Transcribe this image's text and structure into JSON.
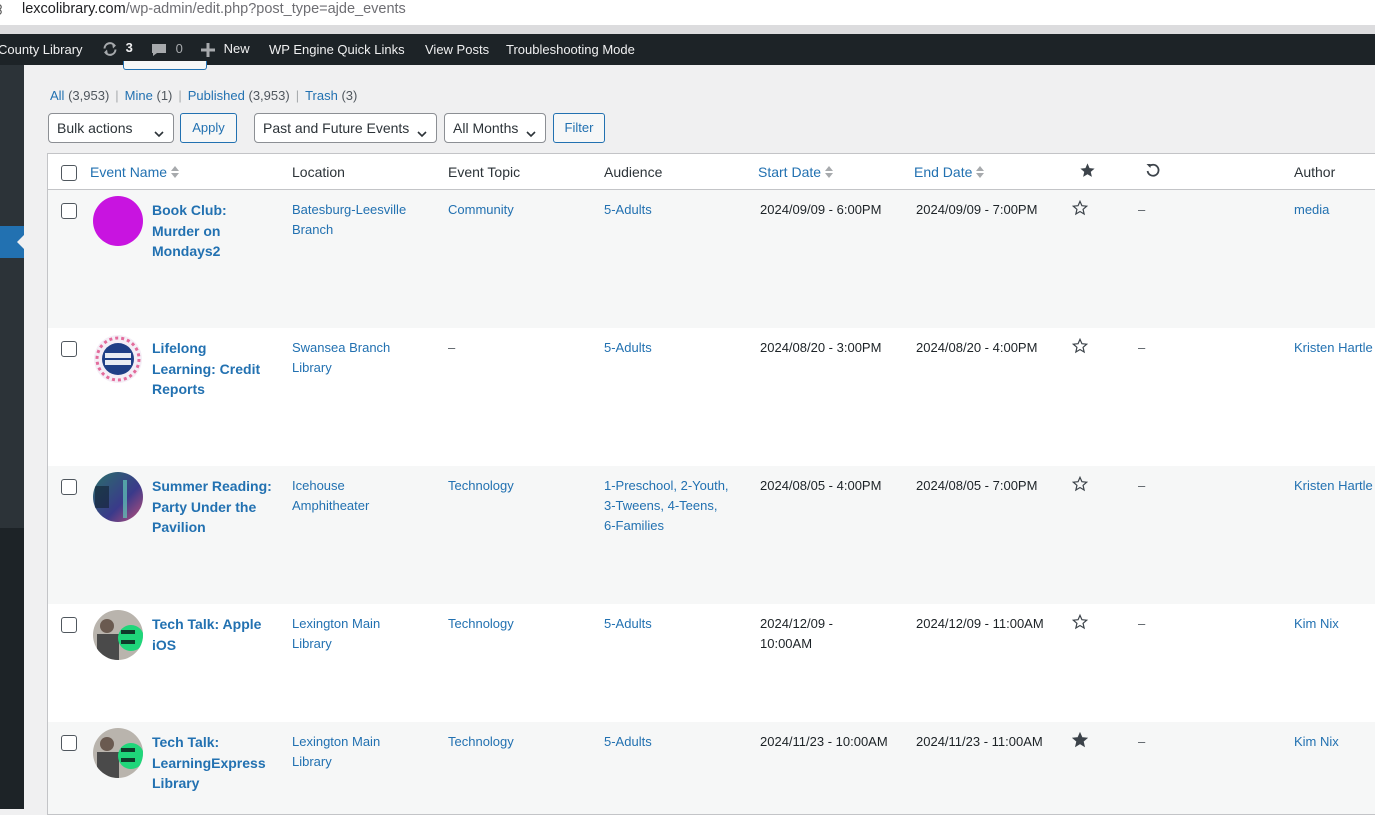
{
  "browser": {
    "url_domain": "lexcolibrary.com",
    "url_path": "/wp-admin/edit.php?post_type=ajde_events"
  },
  "adminbar": {
    "site_name": "County Library",
    "updates_count": "3",
    "comments_count": "0",
    "new_label": "New",
    "quick_links": "WP Engine Quick Links",
    "view_posts": "View Posts",
    "troubleshooting": "Troubleshooting Mode"
  },
  "filters": {
    "all_label": "All",
    "all_count": "(3,953)",
    "mine_label": "Mine",
    "mine_count": "(1)",
    "published_label": "Published",
    "published_count": "(3,953)",
    "trash_label": "Trash",
    "trash_count": "(3)",
    "separator": "|"
  },
  "controls": {
    "bulk_actions": "Bulk actions",
    "apply": "Apply",
    "event_range": "Past and Future Events",
    "months": "All Months",
    "filter": "Filter"
  },
  "columns": {
    "event_name": "Event Name",
    "location": "Location",
    "event_topic": "Event Topic",
    "audience": "Audience",
    "start_date": "Start Date",
    "end_date": "End Date",
    "author": "Author"
  },
  "rows": [
    {
      "title_lines": [
        "Book Club:",
        "Murder on",
        "Mondays2"
      ],
      "location_lines": [
        "Batesburg-Leesville",
        "Branch"
      ],
      "topic": "Community",
      "audience_lines": [
        "5-Adults"
      ],
      "start": "2024/09/09 - 6:00PM",
      "end": "2024/09/09 - 7:00PM",
      "featured": false,
      "repeat": "–",
      "author": "media"
    },
    {
      "title_lines": [
        "Lifelong",
        "Learning: Credit",
        "Reports"
      ],
      "location_lines": [
        "Swansea Branch",
        "Library"
      ],
      "topic": "–",
      "audience_lines": [
        "5-Adults"
      ],
      "start": "2024/08/20 - 3:00PM",
      "end": "2024/08/20 - 4:00PM",
      "featured": false,
      "repeat": "–",
      "author": "Kristen Hartle"
    },
    {
      "title_lines": [
        "Summer Reading:",
        "Party Under the",
        "Pavilion"
      ],
      "location_lines": [
        "Icehouse",
        "Amphitheater"
      ],
      "topic": "Technology",
      "audience_lines": [
        "1-Preschool, 2-Youth,",
        "3-Tweens, 4-Teens,",
        "6-Families"
      ],
      "start": "2024/08/05 - 4:00PM",
      "end": "2024/08/05 - 7:00PM",
      "featured": false,
      "repeat": "–",
      "author": "Kristen Hartle"
    },
    {
      "title_lines": [
        "Tech Talk: Apple",
        "iOS"
      ],
      "location_lines": [
        "Lexington Main",
        "Library"
      ],
      "topic": "Technology",
      "audience_lines": [
        "5-Adults"
      ],
      "start_lines": [
        "2024/12/09 -",
        "10:00AM"
      ],
      "end": "2024/12/09 - 11:00AM",
      "featured": false,
      "repeat": "–",
      "author": "Kim Nix"
    },
    {
      "title_lines": [
        "Tech Talk:",
        "LearningExpress",
        "Library"
      ],
      "location_lines": [
        "Lexington Main",
        "Library"
      ],
      "topic": "Technology",
      "audience_lines": [
        "5-Adults"
      ],
      "start": "2024/11/23 - 10:00AM",
      "end": "2024/11/23 - 11:00AM",
      "featured": true,
      "repeat": "–",
      "author": "Kim Nix"
    }
  ],
  "colors": {
    "link": "#2271b1",
    "admin_bar": "#1d2327",
    "avatar_purple": "#c814e0"
  },
  "icons": {
    "updates": "refresh-icon",
    "comments": "comment-icon",
    "new": "plus-icon",
    "featured_column": "star-icon",
    "repeat_column": "undo-icon"
  }
}
